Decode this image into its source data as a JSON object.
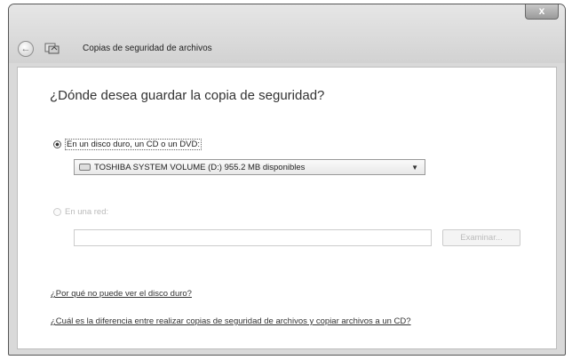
{
  "window": {
    "title": "Copias de seguridad de archivos",
    "close_symbol": "x",
    "back_symbol": "←"
  },
  "main": {
    "question": "¿Dónde desea guardar la copia de seguridad?",
    "option_disk": {
      "label": "En un disco duro, un CD o un DVD:",
      "selected": true
    },
    "drive_select": {
      "value": "TOSHIBA SYSTEM VOLUME (D:)  955.2 MB disponibles",
      "arrow": "▼"
    },
    "option_network": {
      "label": "En una red:",
      "selected": false
    },
    "network_path": {
      "value": "",
      "placeholder": ""
    },
    "browse_label": "Examinar...",
    "link_why": "¿Por qué no puede ver el disco duro?",
    "link_difference": "¿Cuál es la diferencia entre realizar copias de seguridad de archivos y copiar archivos a un CD?"
  },
  "icons": {
    "back": "back-arrow-icon",
    "app": "backup-app-icon",
    "drive": "hard-drive-icon",
    "dropdown": "chevron-down-icon"
  }
}
